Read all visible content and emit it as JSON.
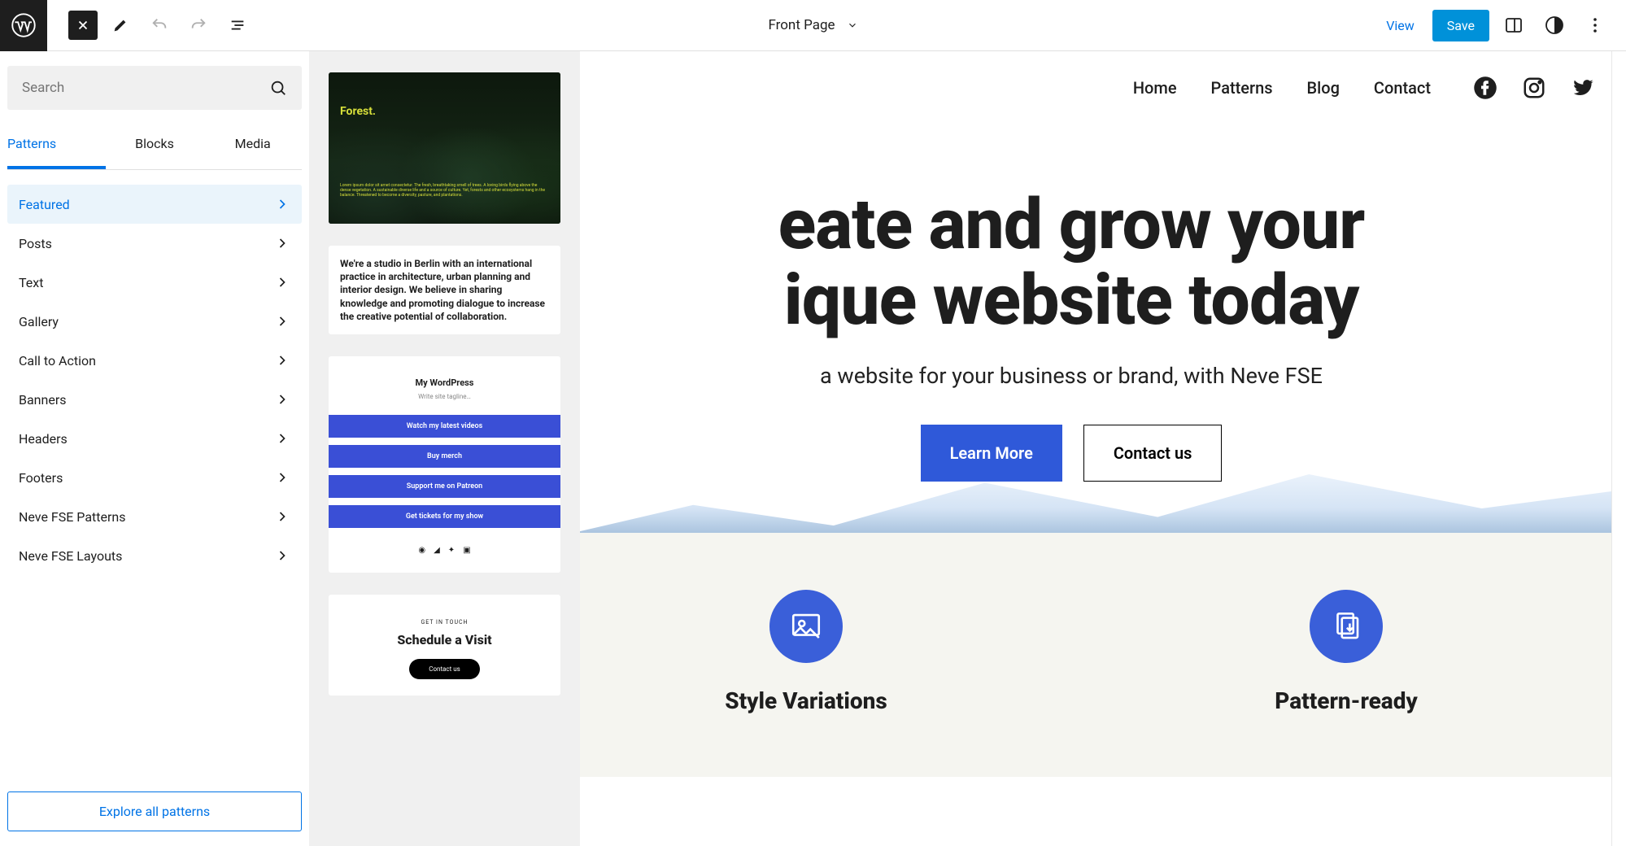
{
  "topbar": {
    "page_title": "Front Page",
    "view_label": "View",
    "save_label": "Save"
  },
  "search": {
    "placeholder": "Search"
  },
  "tabs": [
    "Patterns",
    "Blocks",
    "Media"
  ],
  "active_tab": 0,
  "categories": [
    {
      "label": "Featured",
      "selected": true
    },
    {
      "label": "Posts"
    },
    {
      "label": "Text"
    },
    {
      "label": "Gallery"
    },
    {
      "label": "Call to Action"
    },
    {
      "label": "Banners"
    },
    {
      "label": "Headers"
    },
    {
      "label": "Footers"
    },
    {
      "label": "Neve FSE Patterns"
    },
    {
      "label": "Neve FSE Layouts"
    }
  ],
  "explore_label": "Explore all patterns",
  "patterns": {
    "forest": {
      "title": "Forest.",
      "desc": "Lorem ipsum dolor sit amet consectetur. The fresh, breathtaking smell of trees. A loving birds flying above the dense vegetation. A sustainable diverse life and a source of culture. Yet, forests and other ecosystems hang in the balance. Threatened to become a diversity, pasture, and plantations."
    },
    "studio": {
      "text": "We're a studio in Berlin with an international practice in architecture, urban planning and interior design. We believe in sharing knowledge and promoting dialogue to increase the creative potential of collaboration."
    },
    "links": {
      "heading": "My WordPress",
      "tagline": "Write site tagline…",
      "items": [
        "Watch my latest videos",
        "Buy merch",
        "Support me on Patreon",
        "Get tickets for my show"
      ]
    },
    "visit": {
      "pre": "GET IN TOUCH",
      "heading": "Schedule a Visit",
      "button": "Contact us"
    }
  },
  "canvas": {
    "nav": [
      "Home",
      "Patterns",
      "Blog",
      "Contact"
    ],
    "hero_line1": "eate and grow your",
    "hero_line2": "ique website today",
    "hero_sub": "a website for your business or brand, with Neve FSE",
    "btn_primary": "Learn More",
    "btn_outline": "Contact us",
    "feature1": "Style Variations",
    "feature2": "Pattern-ready"
  }
}
